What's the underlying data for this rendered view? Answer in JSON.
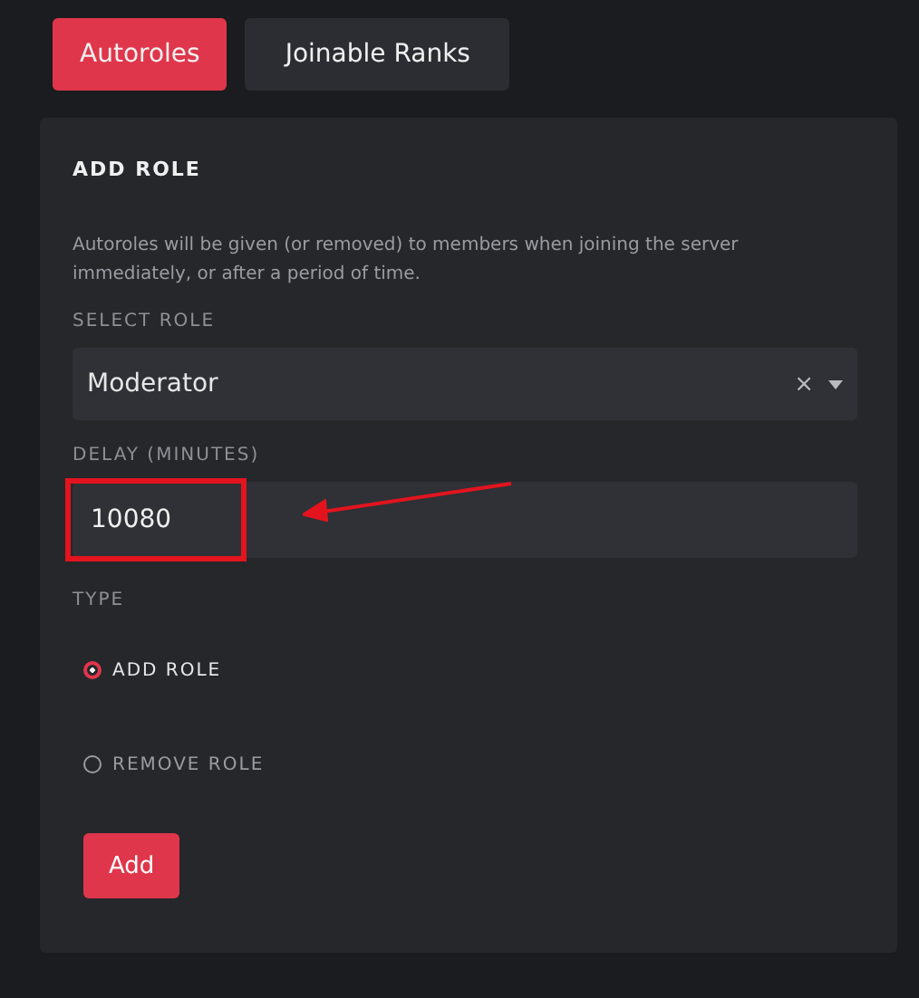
{
  "tabs": [
    {
      "label": "Autoroles",
      "selected": true
    },
    {
      "label": "Joinable Ranks",
      "selected": false
    }
  ],
  "panel": {
    "title": "ADD ROLE",
    "description": "Autoroles will be given (or removed) to members when joining the server immediately, or after a period of time.",
    "select_role": {
      "label": "SELECT ROLE",
      "value": "Moderator",
      "clear": "×"
    },
    "delay": {
      "label": "DELAY (MINUTES)",
      "value": "10080"
    },
    "type": {
      "label": "TYPE",
      "options": [
        {
          "label": "ADD ROLE",
          "selected": true
        },
        {
          "label": "REMOVE ROLE",
          "selected": false
        }
      ]
    },
    "button": "Add"
  }
}
